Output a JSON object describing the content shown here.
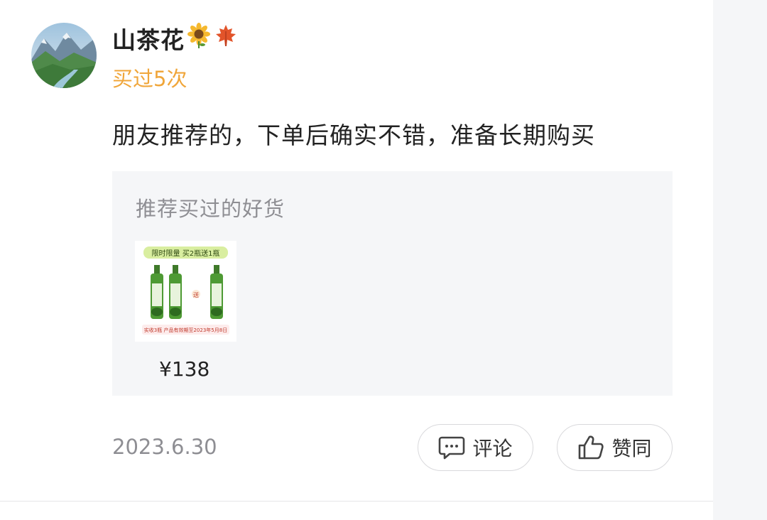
{
  "review": {
    "username": "山茶花",
    "username_emojis": [
      "🌻",
      "🍁"
    ],
    "bought_badge": "买过5次",
    "text": "朋友推荐的，下单后确实不错，准备长期购买",
    "date": "2023.6.30"
  },
  "recommend": {
    "title": "推荐买过的好货",
    "product": {
      "banner": "限时限量 买2瓶送1瓶",
      "gift_mark": "送",
      "footer": "实收3瓶 产品有效期至2023年5月8日",
      "price": "¥138"
    }
  },
  "actions": {
    "comment_label": "评论",
    "like_label": "赞同"
  },
  "colors": {
    "badge": "#f0a63a",
    "card_bg": "#f5f6f8",
    "muted_text": "#8e8e93"
  }
}
